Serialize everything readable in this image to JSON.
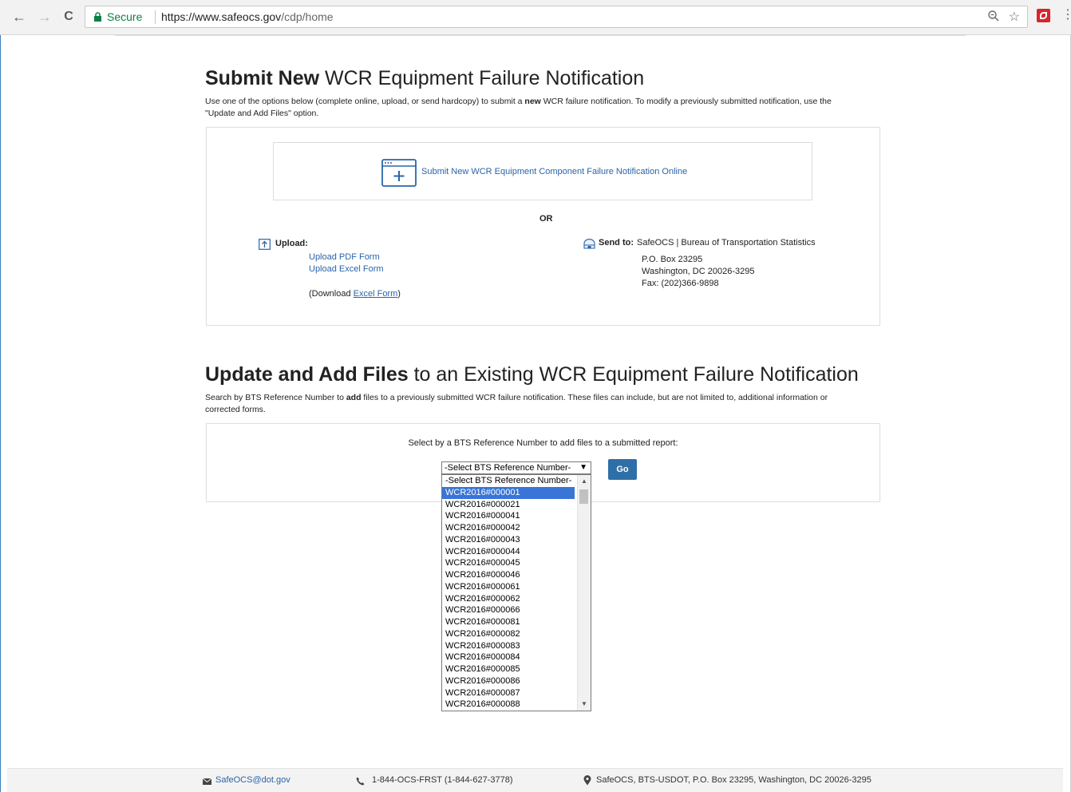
{
  "browser": {
    "back_glyph": "←",
    "forward_glyph": "→",
    "reload_glyph": "C",
    "secure_label": "Secure",
    "url_host": "https://www.safeocs.gov",
    "url_path": "/cdp/home",
    "star_glyph": "☆",
    "menu_glyph": "⋮"
  },
  "submit_section": {
    "title_bold": "Submit New",
    "title_rest": " WCR Equipment Failure Notification",
    "desc_pre": "Use one of the options below (complete online, upload, or send hardcopy) to submit a ",
    "desc_bold": "new",
    "desc_post": " WCR failure notification. To modify a previously submitted notification, use the \"Update and Add Files\" option.",
    "online_link": "Submit New WCR Equipment Component Failure Notification Online",
    "or_label": "OR",
    "upload_label": "Upload:",
    "upload_pdf": "Upload PDF Form",
    "upload_excel": "Upload Excel Form",
    "download_pre": "(Download ",
    "download_link": "Excel Form",
    "download_post": ")",
    "sendto_label": "Send to:",
    "sendto_org": "SafeOCS | Bureau of Transportation Statistics",
    "address_line1": "P.O. Box 23295",
    "address_line2": "Washington, DC 20026-3295",
    "fax": "Fax: (202)366-9898"
  },
  "update_section": {
    "title_bold": "Update and Add Files",
    "title_rest": " to an Existing WCR Equipment Failure Notification",
    "desc_pre": "Search by BTS Reference Number to ",
    "desc_bold": "add",
    "desc_post": " files to a previously submitted WCR failure notification. These files can include, but are not limited to, additional information or corrected forms.",
    "select_prompt": "Select by a BTS Reference Number to add files to a submitted report:",
    "select_value": "-Select BTS Reference Number-",
    "go_label": "Go",
    "options": [
      "-Select BTS Reference Number-",
      "WCR2016#000001",
      "WCR2016#000021",
      "WCR2016#000041",
      "WCR2016#000042",
      "WCR2016#000043",
      "WCR2016#000044",
      "WCR2016#000045",
      "WCR2016#000046",
      "WCR2016#000061",
      "WCR2016#000062",
      "WCR2016#000066",
      "WCR2016#000081",
      "WCR2016#000082",
      "WCR2016#000083",
      "WCR2016#000084",
      "WCR2016#000085",
      "WCR2016#000086",
      "WCR2016#000087",
      "WCR2016#000088"
    ],
    "highlighted_option": "WCR2016#000001"
  },
  "footer": {
    "email": "SafeOCS@dot.gov",
    "phone": "1-844-OCS-FRST (1-844-627-3778)",
    "address": "SafeOCS, BTS-USDOT, P.O. Box 23295, Washington, DC 20026-3295"
  },
  "colors": {
    "link": "#2a64a8",
    "go_button": "#2f6fa8",
    "secure_green": "#0b8043",
    "selected_option": "#3875d7"
  }
}
